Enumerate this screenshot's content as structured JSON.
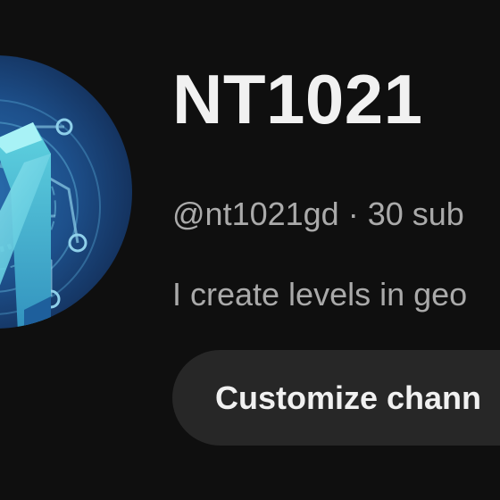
{
  "channel": {
    "title": "NT1021",
    "handle": "@nt1021gd",
    "separator": "·",
    "subscribers": "30 sub",
    "description": "I create levels in geo"
  },
  "actions": {
    "customize_label": "Customize chann"
  },
  "avatar": {
    "icon": "nt-logo-icon",
    "colors": {
      "dark_blue": "#14325e",
      "mid_blue": "#1d4f8a",
      "accent_teal": "#5fd3e0",
      "light_blue": "#8fe6f0"
    }
  },
  "colors": {
    "background": "#0f0f0f",
    "title_text": "#f1f1f1",
    "secondary_text": "#aaaaaa",
    "button_background": "#272727"
  }
}
